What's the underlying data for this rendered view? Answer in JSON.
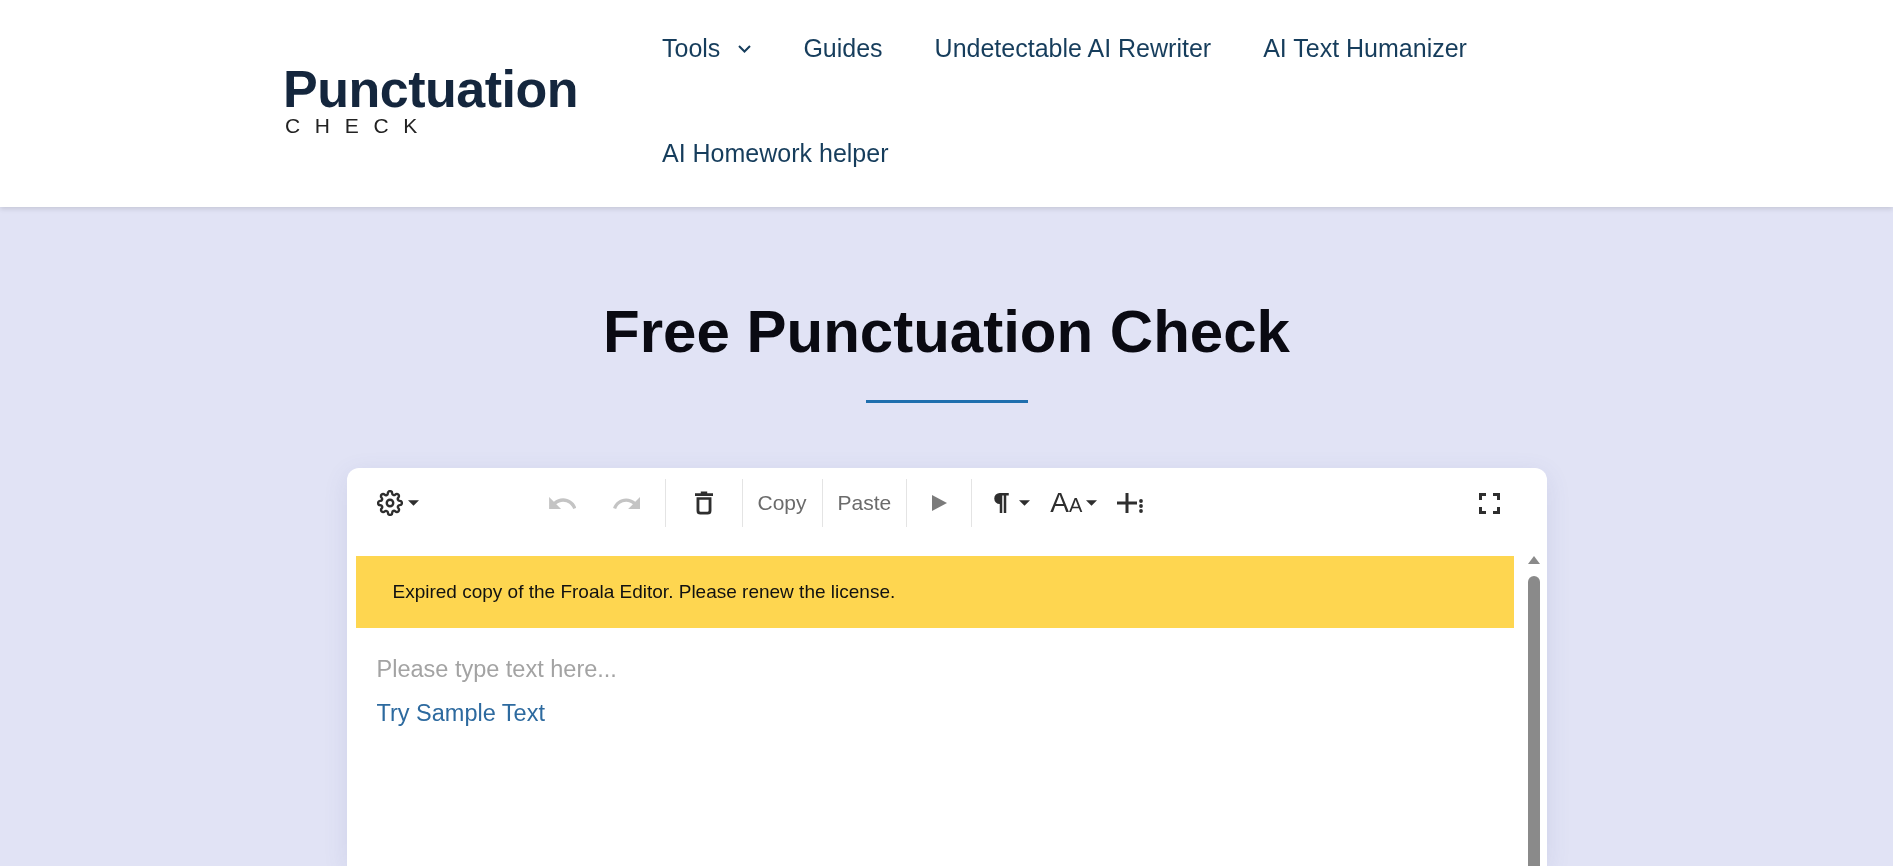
{
  "header": {
    "logo": {
      "wordmark": "Punctuation",
      "tagline": "CHECK"
    },
    "nav": [
      {
        "label": "Tools",
        "kind": "dropdown"
      },
      {
        "label": "Guides",
        "kind": "link"
      },
      {
        "label": "Undetectable AI Rewriter",
        "kind": "link"
      },
      {
        "label": "AI Text Humanizer",
        "kind": "link"
      },
      {
        "label": "AI Homework helper",
        "kind": "link"
      }
    ]
  },
  "hero": {
    "title": "Free Punctuation Check"
  },
  "editor": {
    "toolbar": {
      "left": [
        {
          "kind": "settings",
          "disabled": false
        }
      ],
      "groups": [
        [
          {
            "kind": "undo",
            "disabled": true
          },
          {
            "kind": "redo",
            "disabled": true
          }
        ],
        [
          {
            "kind": "clear",
            "disabled": false
          }
        ],
        [
          {
            "kind": "copy",
            "label": "Copy",
            "disabled": false
          }
        ],
        [
          {
            "kind": "paste",
            "label": "Paste",
            "disabled": false
          }
        ],
        [
          {
            "kind": "run",
            "disabled": false
          }
        ],
        [
          {
            "kind": "paragraph",
            "disabled": false
          },
          {
            "kind": "fontsize",
            "label": "AA",
            "disabled": false
          },
          {
            "kind": "insert",
            "disabled": false
          }
        ]
      ],
      "right": [
        {
          "kind": "fullscreen",
          "disabled": false
        }
      ]
    },
    "notice": "Expired copy of the Froala Editor. Please renew the license.",
    "placeholder": "Please type text here...",
    "sample_link": "Try Sample Text"
  }
}
